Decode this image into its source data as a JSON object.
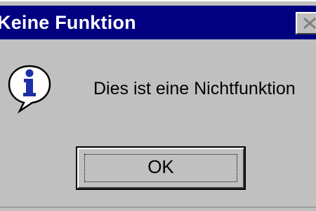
{
  "dialog": {
    "title": "Keine Funktion",
    "message": "Dies ist eine Nichtfunktion",
    "ok_label": "OK",
    "icon": "info-icon"
  },
  "colors": {
    "titlebar": "#000080",
    "face": "#c0c0c0",
    "icon_blue": "#1c2fa8"
  }
}
